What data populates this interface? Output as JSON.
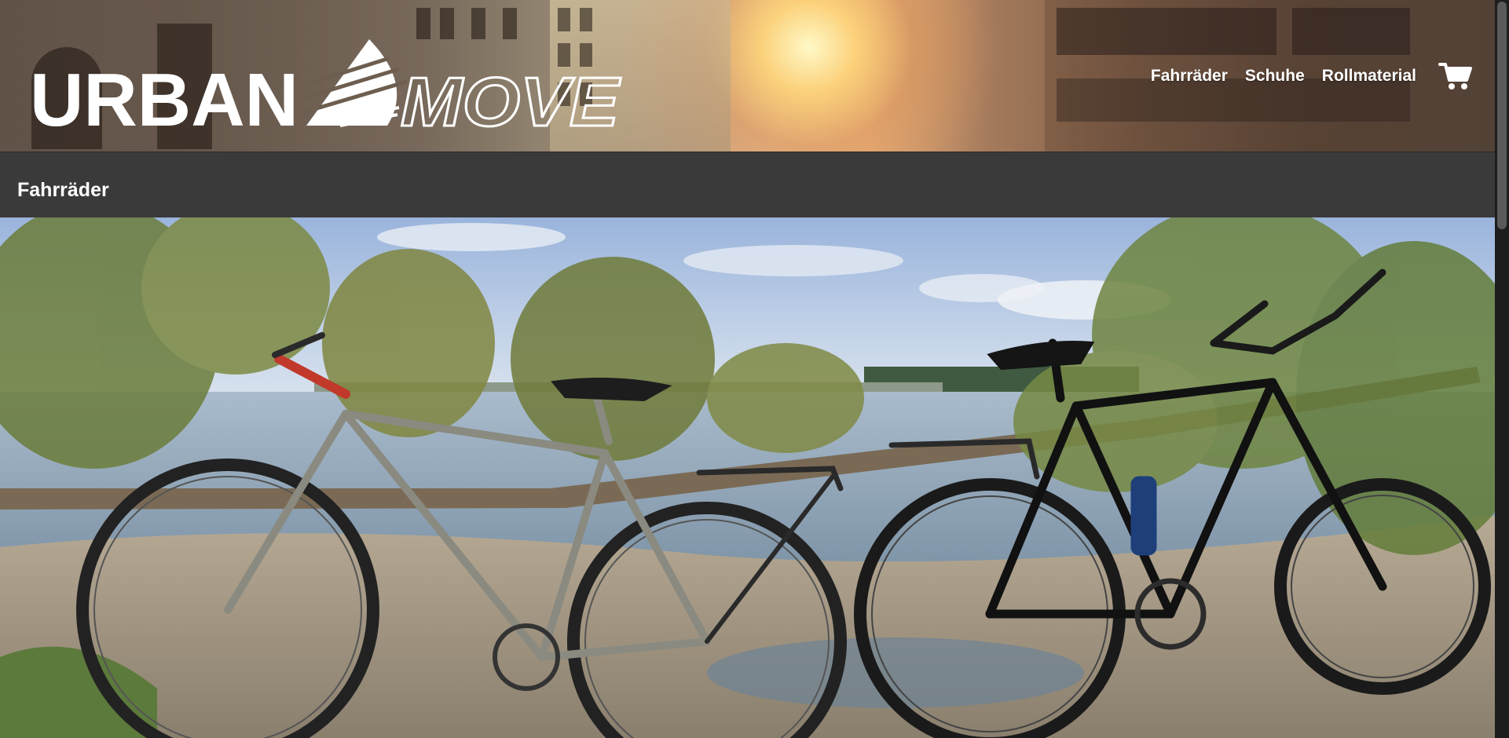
{
  "brand": {
    "logo_text_left": "URBAN",
    "logo_text_right": "MOVE"
  },
  "nav": {
    "items": [
      {
        "label": "Fahrräder"
      },
      {
        "label": "Schuhe"
      },
      {
        "label": "Rollmaterial"
      }
    ],
    "cart_icon": "shopping-cart-icon"
  },
  "page": {
    "title": "Fahrräder"
  },
  "hero": {
    "image": "photo of two mountain bikes parked on a riverbank under trees"
  },
  "colors": {
    "title_bar": "#3a3a3a",
    "nav_text": "#ffffff",
    "scrollbar_track": "#1d1d1d",
    "scrollbar_thumb": "#5a5a5a"
  }
}
